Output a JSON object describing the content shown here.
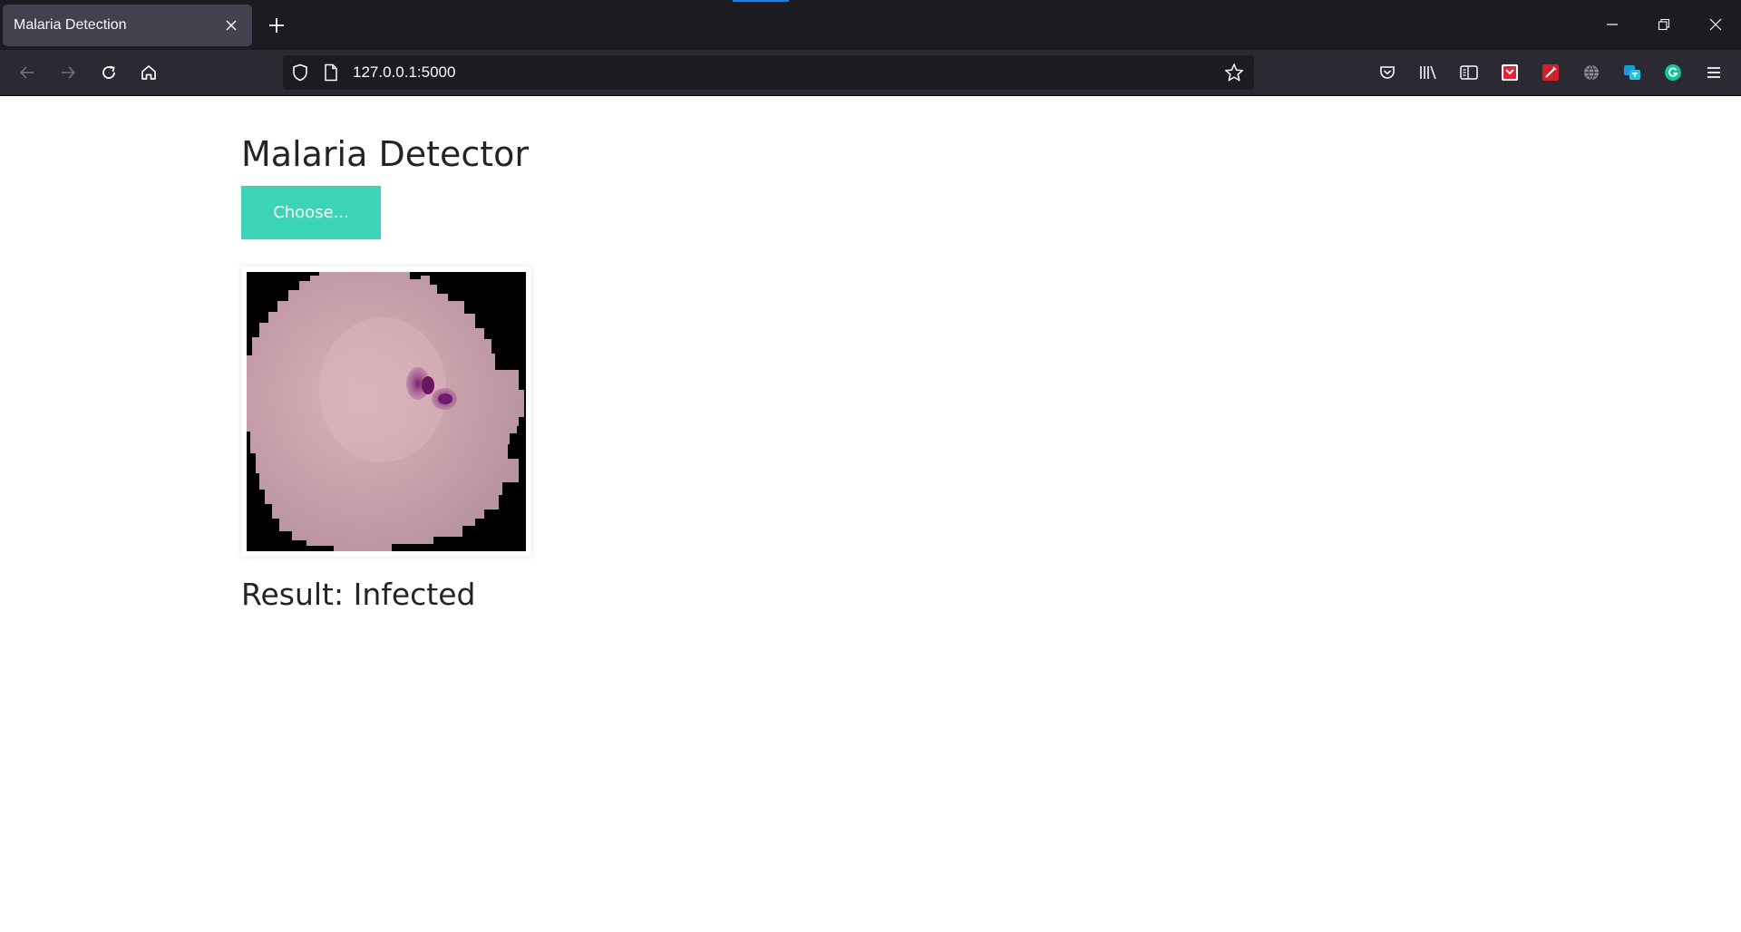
{
  "browser": {
    "tab": {
      "title": "Malaria Detection"
    },
    "url": "127.0.0.1:5000",
    "colors": {
      "tab_strip": "#1c1b22",
      "toolbar": "#2b2a33",
      "active_tab": "#42414d",
      "tab_indicator": "#0a84ff"
    }
  },
  "page": {
    "title": "Malaria Detector",
    "choose_button": "Choose...",
    "image_alt": "blood cell image",
    "result_label": "Result:",
    "result_value": "Infected",
    "colors": {
      "button": "#3bd4b6",
      "text": "#212529"
    }
  }
}
